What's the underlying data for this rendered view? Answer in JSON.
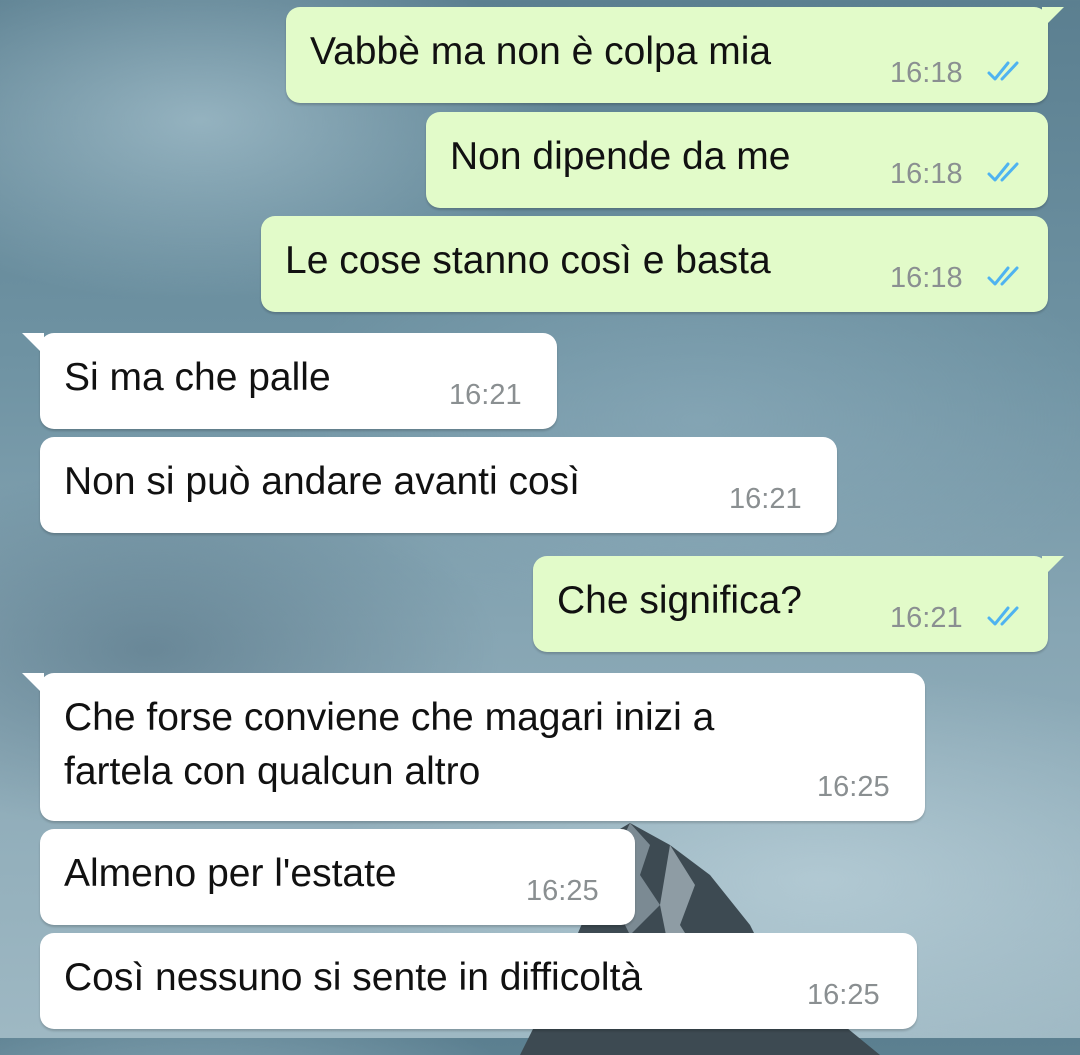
{
  "conversation": {
    "messages": [
      {
        "direction": "outgoing",
        "text": "Vabbè ma non è colpa mia",
        "time": "16:18",
        "status_icon": "read-receipt-double-check-icon"
      },
      {
        "direction": "outgoing",
        "text": "Non dipende da me",
        "time": "16:18",
        "status_icon": "read-receipt-double-check-icon"
      },
      {
        "direction": "outgoing",
        "text": "Le cose stanno così e basta",
        "time": "16:18",
        "status_icon": "read-receipt-double-check-icon"
      },
      {
        "direction": "incoming",
        "text": "Si ma che palle",
        "time": "16:21"
      },
      {
        "direction": "incoming",
        "text": "Non si può andare avanti così",
        "time": "16:21"
      },
      {
        "direction": "outgoing",
        "text": "Che significa?",
        "time": "16:21",
        "status_icon": "read-receipt-double-check-icon"
      },
      {
        "direction": "incoming",
        "text": "Che forse conviene che magari inizi a\nfartela con qualcun altro",
        "time": "16:25"
      },
      {
        "direction": "incoming",
        "text": "Almeno per l'estate",
        "time": "16:25"
      },
      {
        "direction": "incoming",
        "text": "Così nessuno si sente in difficoltà",
        "time": "16:25"
      }
    ]
  },
  "colors": {
    "outgoing_bubble": "#e2fbc9",
    "incoming_bubble": "#ffffff",
    "timestamp": "#8a8f91",
    "read_tick": "#4fb3f0",
    "wallpaper": "#6f93a3"
  }
}
